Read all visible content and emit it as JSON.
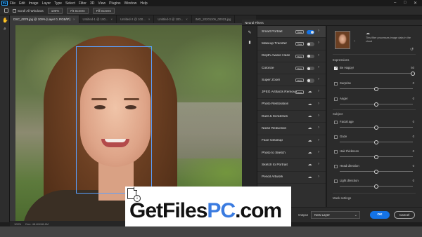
{
  "menubar": {
    "app_icon": "Ps",
    "items": [
      "File",
      "Edit",
      "Image",
      "Layer",
      "Type",
      "Select",
      "Filter",
      "3D",
      "View",
      "Plugins",
      "Window",
      "Help"
    ]
  },
  "options_bar": {
    "scroll_all_windows": "Scroll All Windows",
    "zoom": "100%",
    "fit_screen": "Fit Screen",
    "fill_screen": "Fill Screen"
  },
  "tabs": [
    {
      "label": "DSC_0078.jpg @ 100% (Layer 0, RGB/8*)",
      "active": true
    },
    {
      "label": "Untitled-1 @ 100...",
      "active": false
    },
    {
      "label": "Untitled-2 @ 100...",
      "active": false
    },
    {
      "label": "Untitled-3 @ 100...",
      "active": false
    },
    {
      "label": "IMG_20201106_00023.jpg",
      "active": false
    }
  ],
  "status_bar": {
    "zoom": "100%",
    "doc": "Doc: 48.4M/48.4M"
  },
  "neural_filters": {
    "panel_title": "Neural Filters",
    "filters": [
      {
        "name": "Smart Portrait",
        "badge": "Beta",
        "control": "toggle-on",
        "active": true
      },
      {
        "name": "Makeup Transfer",
        "badge": "Beta",
        "control": "toggle-off",
        "active": false
      },
      {
        "name": "Depth-Aware Haze",
        "badge": "Beta",
        "control": "toggle-off",
        "active": false
      },
      {
        "name": "Colorize",
        "badge": "Beta",
        "control": "toggle-off",
        "active": false
      },
      {
        "name": "Super Zoom",
        "badge": "Beta",
        "control": "toggle-off",
        "active": false
      },
      {
        "name": "JPEG Artifacts Removal",
        "badge": "Beta",
        "control": "cloud",
        "active": false
      },
      {
        "name": "Photo Restoration",
        "badge": "",
        "control": "cloud",
        "active": false
      },
      {
        "name": "Dust & Scratches",
        "badge": "",
        "control": "cloud",
        "active": false
      },
      {
        "name": "Noise Reduction",
        "badge": "",
        "control": "cloud",
        "active": false
      },
      {
        "name": "Face Cleanup",
        "badge": "",
        "control": "cloud",
        "active": false
      },
      {
        "name": "Photo to Sketch",
        "badge": "",
        "control": "cloud",
        "active": false
      },
      {
        "name": "Sketch to Portrait",
        "badge": "",
        "control": "cloud",
        "active": false
      },
      {
        "name": "Pencil Artwork",
        "badge": "",
        "control": "cloud",
        "active": false
      }
    ]
  },
  "settings": {
    "cloud_note": "This filter processes image data in the cloud",
    "expressions_title": "Expressions",
    "subject_title": "Subject",
    "mask_settings": "Mask settings",
    "expressions": [
      {
        "label": "Be Happy!",
        "value": "50",
        "checked": true,
        "level": 1.0
      },
      {
        "label": "Surprise",
        "value": "0",
        "checked": false,
        "level": 0.5
      },
      {
        "label": "Anger",
        "value": "0",
        "checked": false,
        "level": 0.5
      }
    ],
    "subject": [
      {
        "label": "Facial age",
        "value": "0",
        "checked": false,
        "level": 0.5
      },
      {
        "label": "Gaze",
        "value": "0",
        "checked": false,
        "level": 0.5
      },
      {
        "label": "Hair thickness",
        "value": "0",
        "checked": false,
        "level": 0.5
      },
      {
        "label": "Head direction",
        "value": "0",
        "checked": false,
        "level": 0.5
      },
      {
        "label": "Light direction",
        "value": "0",
        "checked": false,
        "level": 0.5
      }
    ]
  },
  "footer": {
    "output_label": "Output",
    "output_value": "New Layer",
    "ok": "OK",
    "cancel": "Cancel"
  },
  "watermark": {
    "part1": "GetFiles",
    "part2": "PC",
    "part3": ".com"
  },
  "colors": {
    "accent": "#1473e6",
    "watermark_blue": "#3a7be0",
    "panel_bg": "#2b2b2b"
  }
}
